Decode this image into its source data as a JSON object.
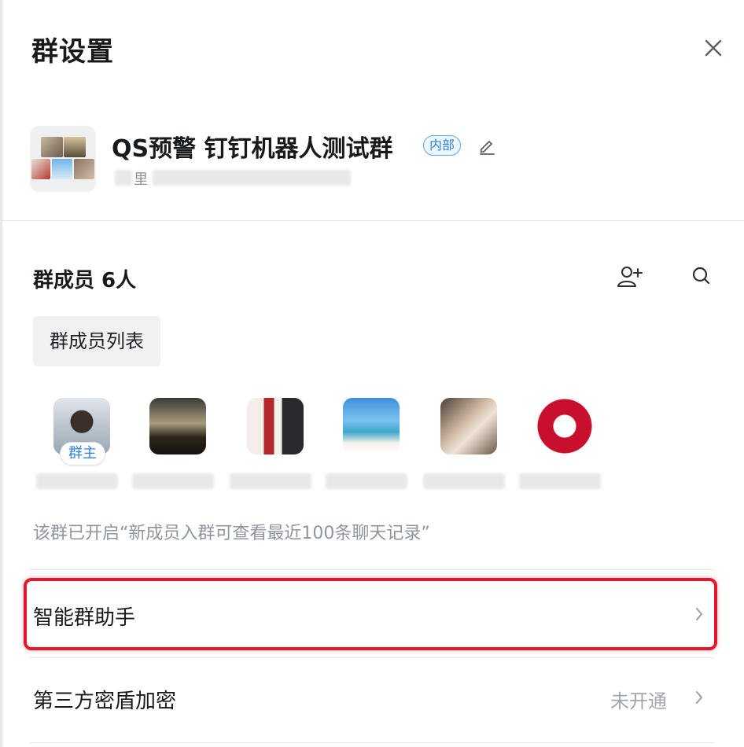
{
  "header": {
    "title": "群设置",
    "close_icon": "close-icon"
  },
  "group": {
    "name": "QS预警 钉钉机器人测试群",
    "badge": "内部",
    "subtitle_visible_char": "里",
    "edit_icon": "pencil-icon"
  },
  "members": {
    "title": "群成员 6人",
    "add_icon": "add-user-icon",
    "search_icon": "search-icon",
    "list_button": "群成员列表",
    "owner_tag": "群主",
    "count": 6
  },
  "notice": "该群已开启“新成员入群可查看最近100条聊天记录”",
  "rows": [
    {
      "label": "智能群助手",
      "value": "",
      "highlighted": true
    },
    {
      "label": "第三方密盾加密",
      "value": "未开通",
      "highlighted": false
    }
  ],
  "colors": {
    "accent_blue": "#2f83e0",
    "highlight_red": "#e3182d",
    "muted_text": "#8f959e"
  }
}
